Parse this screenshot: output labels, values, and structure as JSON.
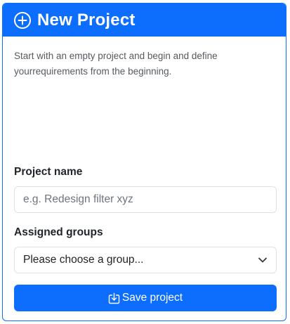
{
  "header": {
    "title": "New Project",
    "icon": "plus-circle-icon",
    "background": "#0d6efd"
  },
  "description": "Start with an empty project and begin and define yourrequirements from the beginning.",
  "form": {
    "project_name_label": "Project name",
    "project_name_placeholder": "e.g. Redesign filter xyz",
    "project_name_value": "",
    "groups_label": "Assigned groups",
    "groups_selected": "Please choose a group...",
    "save_label": "Save project",
    "save_icon": "download-box-icon",
    "accent": "#0d6efd"
  }
}
